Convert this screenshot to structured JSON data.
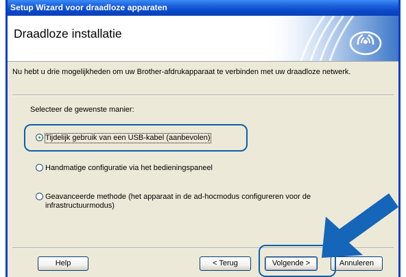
{
  "window": {
    "title": "Setup Wizard voor draadloze apparaten"
  },
  "header": {
    "title": "Draadloze installatie",
    "logo_icon": "wireless-signal-icon"
  },
  "intro": "Nu hebt u drie mogelijkheden om uw Brother-afdrukapparaat te verbinden met uw draadloze netwerk.",
  "prompt": "Selecteer de gewenste manier:",
  "options": [
    {
      "label": "Tijdelijk gebruik van een USB-kabel (aanbevolen)",
      "selected": true
    },
    {
      "label": "Handmatige configuratie via het bedieningspaneel",
      "selected": false
    },
    {
      "label": "Geavanceerde methode (het apparaat in de ad-hocmodus configureren voor de infrastructuurmodus)",
      "selected": false
    }
  ],
  "buttons": {
    "help": "Help",
    "back": "< Terug",
    "next": "Volgende >",
    "cancel": "Annuleren"
  },
  "colors": {
    "accent": "#0b5fa8",
    "titlebar": "#0a48c8",
    "arrow": "#1565b8"
  }
}
